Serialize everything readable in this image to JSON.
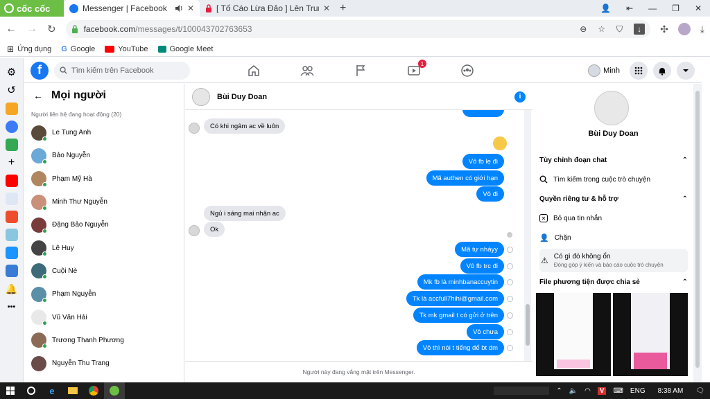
{
  "browser": {
    "brand": "cốc cốc",
    "tabs": [
      {
        "title": "Messenger | Facebook",
        "active": true,
        "icon": "facebook-icon",
        "audio": true
      },
      {
        "title": "[ Tố Cáo Lừa Đảo ] Lên Trung",
        "active": false,
        "icon": "lock-icon"
      }
    ],
    "new_tab": "+",
    "url_host": "facebook.com",
    "url_path": "/messages/t/100043702763653"
  },
  "bookmarks": [
    {
      "label": "Ứng dụng",
      "icon": "apps-grid-icon"
    },
    {
      "label": "Google",
      "icon": "google-icon"
    },
    {
      "label": "YouTube",
      "icon": "youtube-icon"
    },
    {
      "label": "Google Meet",
      "icon": "google-meet-icon"
    }
  ],
  "fb_header": {
    "search_placeholder": "Tìm kiếm trên Facebook",
    "nav_icons": [
      "home-icon",
      "friends-icon",
      "pages-flag-icon",
      "watch-icon",
      "groups-icon"
    ],
    "watch_badge": "1",
    "profile_name": "Minh"
  },
  "contacts": {
    "title": "Mọi người",
    "subtitle": "Người liên hệ đang hoạt động (20)",
    "items": [
      {
        "name": "Le Tung Anh",
        "color": "#5a4a3a"
      },
      {
        "name": "Bảo Nguyễn",
        "color": "#6aa9d8"
      },
      {
        "name": "Phạm Mỹ Hà",
        "color": "#b08660"
      },
      {
        "name": "Minh Thư Nguyễn",
        "color": "#c9907a"
      },
      {
        "name": "Đặng Bảo Nguyễn",
        "color": "#7a3b3b"
      },
      {
        "name": "Lê Huy",
        "color": "#444444"
      },
      {
        "name": "Cuội Nè",
        "color": "#3d6b7a"
      },
      {
        "name": "Phạm Nguyễn",
        "color": "#5b8fa8"
      },
      {
        "name": "Vũ Văn Hải",
        "color": "#e8e8e8"
      },
      {
        "name": "Trương Thanh Phương",
        "color": "#8b6b55"
      },
      {
        "name": "Nguyễn Thu Trang",
        "color": "#6b4a4a"
      }
    ]
  },
  "chat": {
    "name": "Bùi Duy Doan",
    "footer": "Người này đang vắng mặt trên Messenger.",
    "messages": [
      {
        "text": "Có khi ngâm ac về luôn",
        "dir": "in"
      },
      {
        "text": "Vô fb lẹ đi",
        "dir": "out"
      },
      {
        "text": "Mã authen có giới hạn",
        "dir": "out"
      },
      {
        "text": "Vô đi",
        "dir": "out"
      },
      {
        "text": "Ngủ i sáng mai nhận ac",
        "dir": "in"
      },
      {
        "text": "Ok",
        "dir": "in"
      },
      {
        "text": "Mã tự nhảyy",
        "dir": "out"
      },
      {
        "text": "Vô fb trc đi",
        "dir": "out"
      },
      {
        "text": "Mk fb là minhbanaccuytin",
        "dir": "out"
      },
      {
        "text": "Tk là accfull7hihi@gmail.com",
        "dir": "out"
      },
      {
        "text": "Tk mk gmail t có gửi ở trên",
        "dir": "out"
      },
      {
        "text": "Vô chưa",
        "dir": "out"
      },
      {
        "text": "Vô thì nói t tiếng để bt dm",
        "dir": "out"
      }
    ]
  },
  "info": {
    "name": "Bùi Duy Doan",
    "sec_custom": "Tùy chỉnh đoạn chat",
    "search_conv": "Tìm kiếm trong cuộc trò chuyện",
    "sec_privacy": "Quyền riêng tư & hỗ trợ",
    "ignore": "Bỏ qua tin nhắn",
    "block": "Chặn",
    "wrong": "Có gì đó không ổn",
    "wrong_sub": "Đóng góp ý kiến và báo cáo cuộc trò chuyện",
    "sec_media": "File phương tiện được chia sẻ"
  },
  "taskbar": {
    "lang": "ENG",
    "time": "8:38 AM"
  },
  "colors": {
    "fb_blue": "#1877f2",
    "messenger_blue": "#0084ff",
    "online_green": "#31a24c",
    "coccoc_green": "#6cbe45"
  }
}
